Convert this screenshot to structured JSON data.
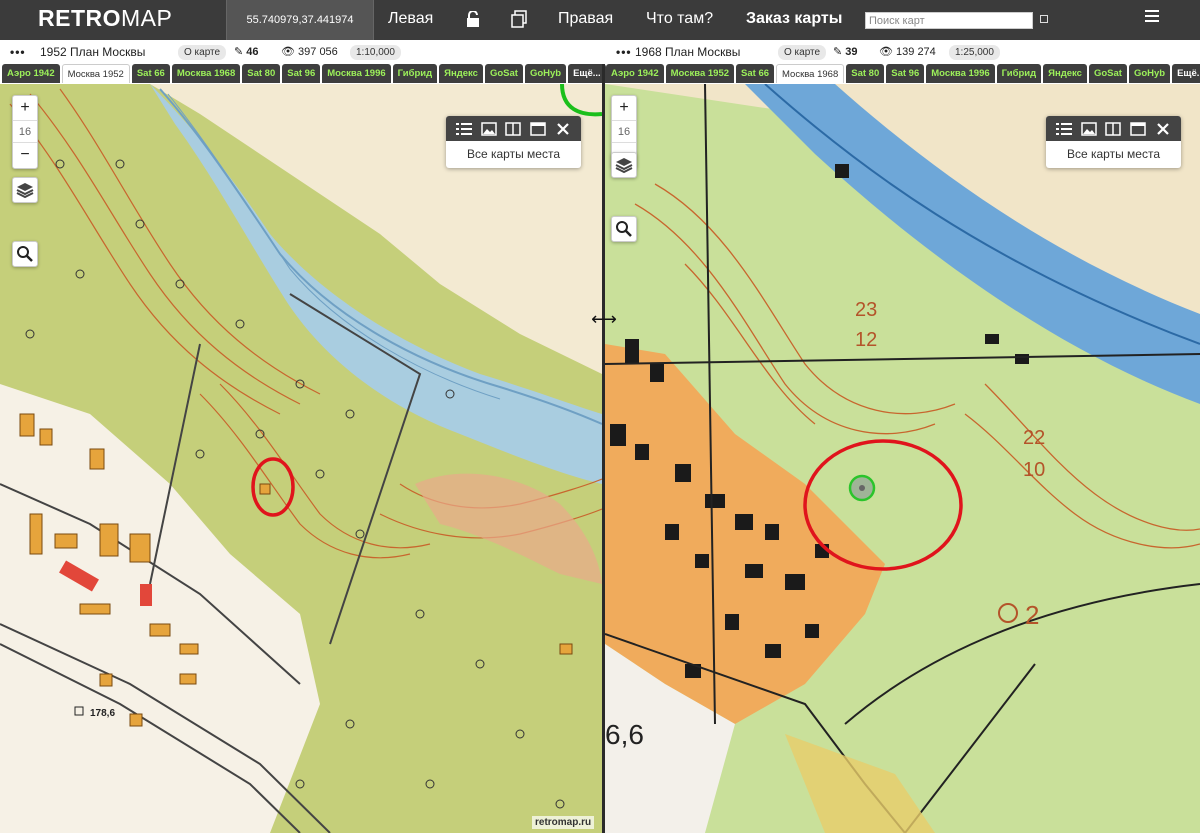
{
  "header": {
    "logo_bold": "RETRO",
    "logo_light": "MAP",
    "coordinates": "55.740979,37.441974",
    "nav_left": "Левая",
    "nav_right": "Правая",
    "nav_what": "Что там?",
    "nav_order": "Заказ карты",
    "search_placeholder": "Поиск карт"
  },
  "left": {
    "dots": "•••",
    "title": "1952 План Москвы",
    "about": "О карте",
    "edits": "46",
    "views": "397 056",
    "scale": "1:10,000",
    "tabs": [
      "Аэро 1942",
      "Москва 1952",
      "Sat 66",
      "Москва 1968",
      "Sat 80",
      "Sat 96",
      "Москва 1996",
      "Гибрид",
      "Яндекс",
      "GoSat",
      "GoHyb",
      "Ещё..."
    ],
    "active_tab": 1,
    "zoom_level": "16",
    "panel_link": "Все карты места",
    "map_label": "178,6",
    "watermark": "retromap.ru"
  },
  "right": {
    "dots": "•••",
    "title": "1968 План Москвы",
    "about": "О карте",
    "edits": "39",
    "views": "139 274",
    "scale": "1:25,000",
    "tabs": [
      "Аэро 1942",
      "Москва 1952",
      "Sat 66",
      "Москва 1968",
      "Sat 80",
      "Sat 96",
      "Москва 1996",
      "Гибрид",
      "Яндекс",
      "GoSat",
      "GoHyb",
      "Ещё..."
    ],
    "active_tab": 3,
    "zoom_level": "16",
    "panel_link": "Все карты места",
    "map_labels": [
      "23",
      "12",
      "22",
      "10",
      "2",
      "6,6"
    ]
  },
  "zoom": {
    "plus": "+",
    "minus": "−"
  },
  "colors": {
    "accent_tab_text": "#9cf05a",
    "topbar": "#3b3b3b",
    "highlight_circle": "#e0141c",
    "river": "#7fb3d5",
    "forest": "#c3cf78",
    "contour": "#c8662e"
  }
}
